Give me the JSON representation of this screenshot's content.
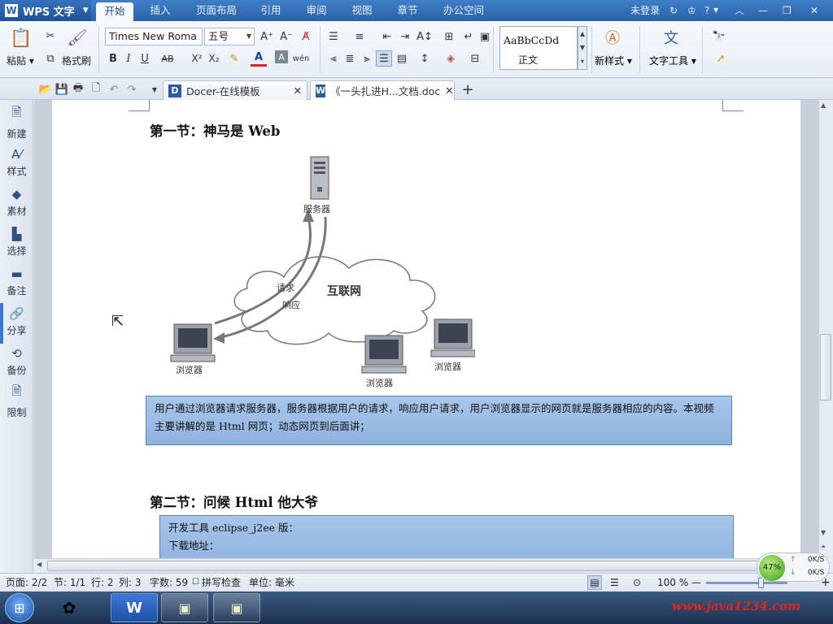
{
  "app": {
    "name": "WPS 文字",
    "logo_letter": "W"
  },
  "menu": {
    "tabs": [
      "开始",
      "插入",
      "页面布局",
      "引用",
      "审阅",
      "视图",
      "章节",
      "办公空间"
    ],
    "active": "开始",
    "right": {
      "login": "未登录",
      "help": "?"
    }
  },
  "ribbon": {
    "paste": "粘贴",
    "format_painter": "格式刷",
    "font_name": "Times New Roma",
    "font_size": "五号",
    "styles_preview": "AaBbCcDd",
    "style_name": "正文",
    "new_style": "新样式",
    "text_tools": "文字工具"
  },
  "doc_tabs": [
    {
      "title": "Docer-在线模板",
      "icon": "D"
    },
    {
      "title": "《一头扎进H...文档.doc",
      "icon": "W"
    }
  ],
  "sidebar": [
    {
      "label": "新建",
      "icon": "new-doc-icon"
    },
    {
      "label": "样式",
      "icon": "style-icon"
    },
    {
      "label": "素材",
      "icon": "material-icon"
    },
    {
      "label": "选择",
      "icon": "select-icon"
    },
    {
      "label": "备注",
      "icon": "note-icon"
    },
    {
      "label": "分享",
      "icon": "share-icon"
    },
    {
      "label": "备份",
      "icon": "backup-icon"
    },
    {
      "label": "限制",
      "icon": "restrict-icon"
    }
  ],
  "document": {
    "section1_title": "第一节：神马是 Web",
    "diagram": {
      "server": "服务器",
      "internet": "互联网",
      "request": "请求",
      "response": "响应",
      "browser": "浏览器"
    },
    "note1": "用户通过浏览器请求服务器，服务器根据用户的请求，响应用户请求，用户浏览器显示的网页就是服务器相应的内容。本视频主要讲解的是 Html 网页；动态网页到后面讲；",
    "section2_title": "第二节：问候 Html 他大爷",
    "note2_line1": "开发工具 eclipse_j2ee 版：",
    "note2_line2": "下载地址："
  },
  "status": {
    "page": "页面: 2/2",
    "section": "节: 1/1",
    "row": "行: 2",
    "col": "列: 3",
    "chars": "字数: 59",
    "spell": "拼写检查",
    "unit": "单位: 毫米",
    "zoom": "100 %"
  },
  "net_widget": {
    "percent": "47%",
    "up": "0K/S",
    "down": "0K/S"
  },
  "watermark": "www.java1234.com"
}
